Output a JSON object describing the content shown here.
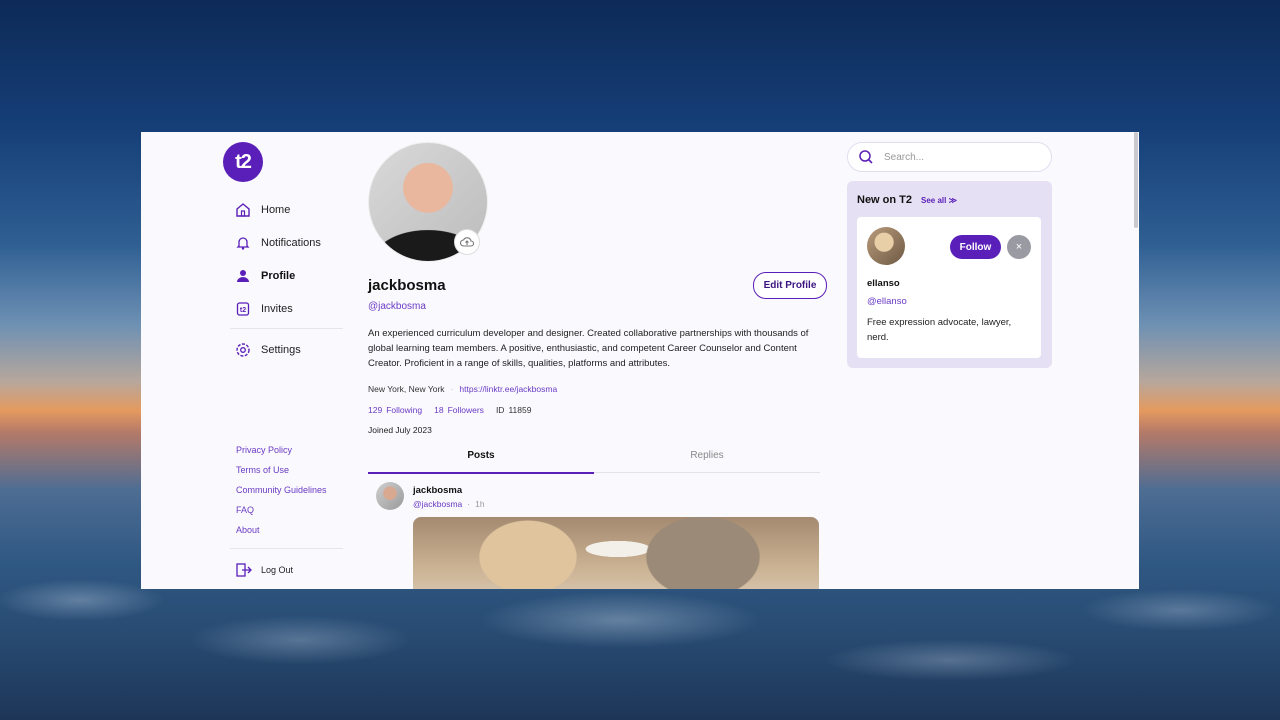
{
  "brand": {
    "logo_text": "t2",
    "accent": "#5a1fb8"
  },
  "nav": {
    "items": [
      {
        "label": "Home",
        "icon": "home-icon"
      },
      {
        "label": "Notifications",
        "icon": "bell-icon"
      },
      {
        "label": "Profile",
        "icon": "user-icon",
        "active": true
      },
      {
        "label": "Invites",
        "icon": "invite-icon"
      },
      {
        "label": "Settings",
        "icon": "gear-icon"
      }
    ],
    "footer_links": [
      "Privacy Policy",
      "Terms of Use",
      "Community Guidelines",
      "FAQ",
      "About"
    ],
    "logout_label": "Log Out"
  },
  "profile": {
    "display_name": "jackbosma",
    "handle": "@jackbosma",
    "edit_label": "Edit Profile",
    "bio": "An experienced curriculum developer and designer. Created collaborative partnerships with thousands of global learning team members. A positive, enthusiastic, and competent Career Counselor and Content Creator. Proficient in a range of skills, qualities, platforms and attributes.",
    "location": "New York, New York",
    "link": "https://linktr.ee/jackbosma",
    "following_count": "129",
    "following_label": "Following",
    "followers_count": "18",
    "followers_label": "Followers",
    "id_label": "ID",
    "id_value": "11859",
    "joined": "Joined July 2023"
  },
  "tabs": [
    {
      "label": "Posts",
      "active": true
    },
    {
      "label": "Replies",
      "active": false
    }
  ],
  "post": {
    "author": "jackbosma",
    "handle": "@jackbosma",
    "separator": "·",
    "time": "1h"
  },
  "search": {
    "placeholder": "Search..."
  },
  "new_on": {
    "title": "New on T2",
    "see_all": "See all ≫",
    "user": {
      "name": "ellanso",
      "handle": "@ellanso",
      "bio": "Free expression advocate, lawyer, nerd.",
      "follow_label": "Follow",
      "dismiss_label": "×"
    }
  }
}
